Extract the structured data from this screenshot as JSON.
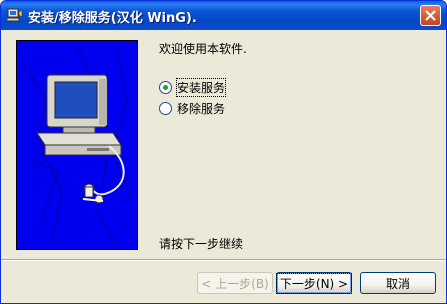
{
  "window": {
    "title": "安装/移除服务(汉化 WinG).",
    "close_icon": "close-icon"
  },
  "main": {
    "welcome": "欢迎使用本软件.",
    "options": [
      {
        "label": "安装服务",
        "checked": true
      },
      {
        "label": "移除服务",
        "checked": false
      }
    ],
    "hint": "请按下一步继续"
  },
  "buttons": {
    "back": "< 上一步(B)",
    "next": "下一步(N) >",
    "cancel": "取消"
  },
  "colors": {
    "banner": "#0000ee",
    "titlebar": "#0a55d6",
    "dialog_bg": "#ece9d8"
  }
}
